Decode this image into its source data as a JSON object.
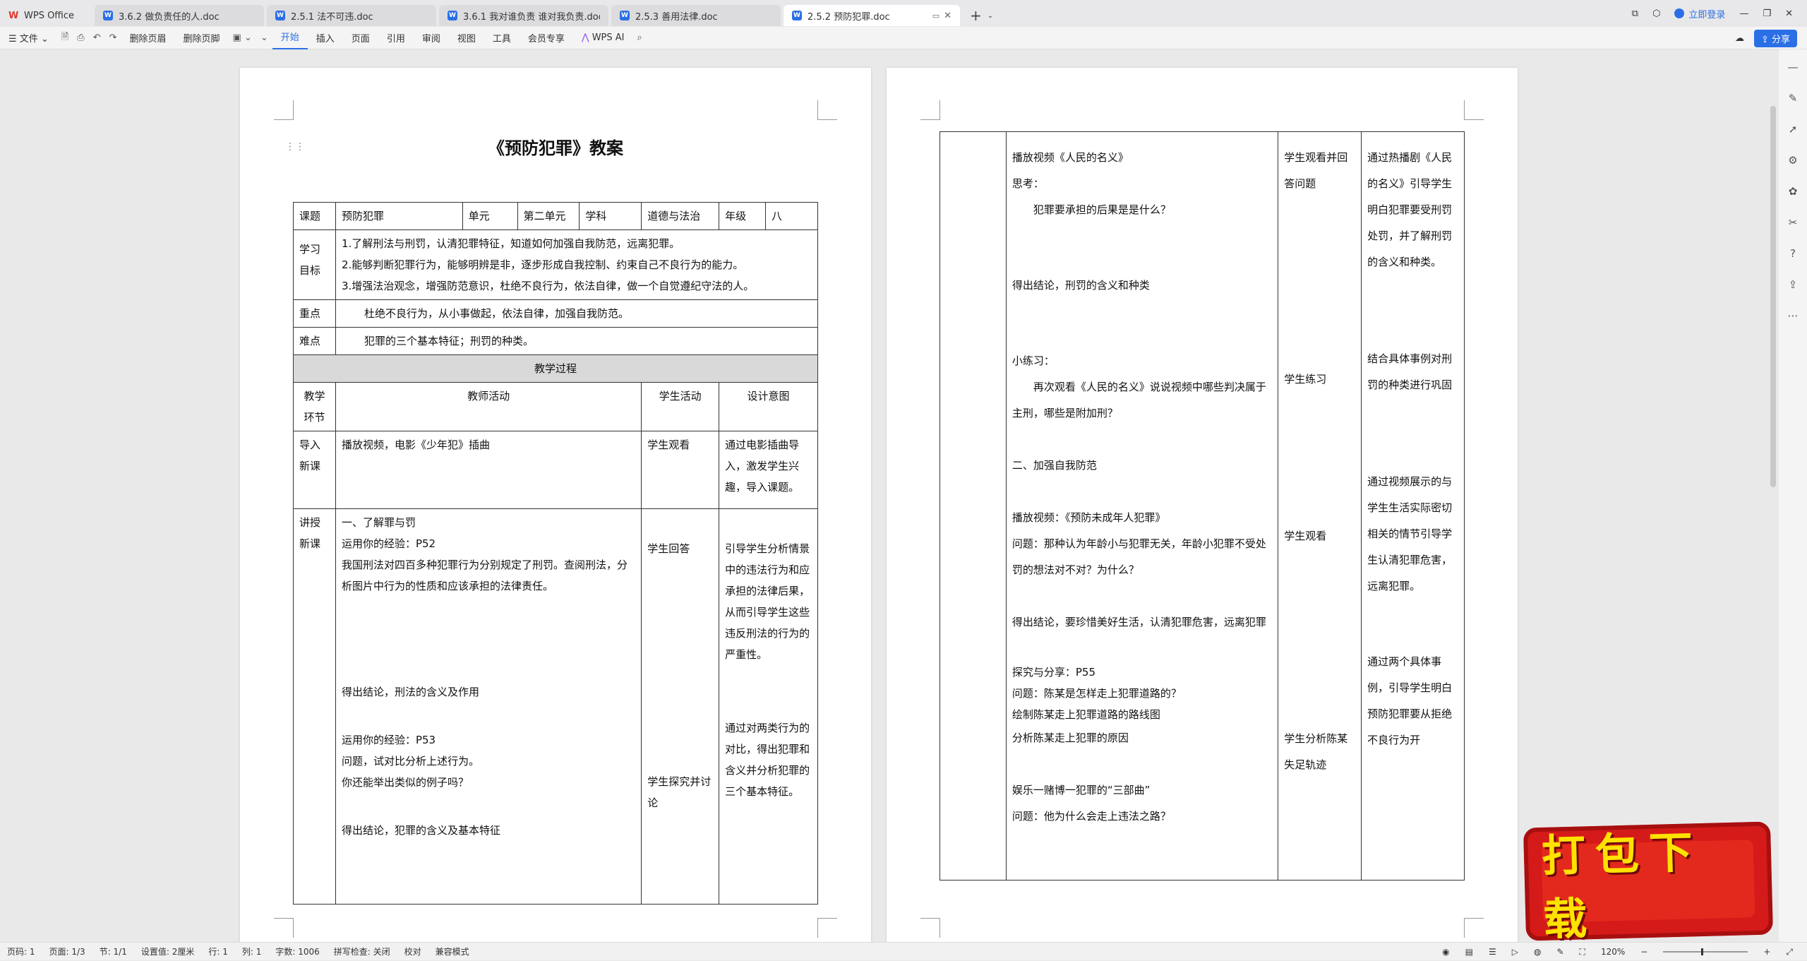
{
  "tabs": {
    "home_label": "WPS Office",
    "items": [
      {
        "label": "3.6.2 做负责任的人.doc"
      },
      {
        "label": "2.5.1 法不可违.doc"
      },
      {
        "label": "3.6.1 我对谁负责 谁对我负责.doc"
      },
      {
        "label": "2.5.3 善用法律.doc"
      },
      {
        "label": "2.5.2 预防犯罪.doc"
      }
    ],
    "login_label": "立即登录"
  },
  "menu": {
    "file": "文件",
    "delete_header": "删除页眉",
    "delete_footer": "删除页脚",
    "items": [
      "开始",
      "插入",
      "页面",
      "引用",
      "审阅",
      "视图",
      "工具",
      "会员专享"
    ],
    "ai_label": "WPS AI",
    "share_label": "分享"
  },
  "doc": {
    "title": "《预防犯罪》教案",
    "info": {
      "k_topic": "课题",
      "v_topic": "预防犯罪",
      "k_unit": "单元",
      "v_unit": "第二单元",
      "k_subject": "学科",
      "v_subject": "道德与法治",
      "k_grade": "年级",
      "v_grade": "八"
    },
    "goals_label": "学习\n目标",
    "goals": [
      "1.了解刑法与刑罚，认清犯罪特征，知道如何加强自我防范，远离犯罪。",
      "2.能够判断犯罪行为，能够明辨是非，逐步形成自我控制、约束自己不良行为的能力。",
      "3.增强法治观念，增强防范意识，杜绝不良行为，依法自律，做一个自觉遵纪守法的人。"
    ],
    "key_label": "重点",
    "key_text": "杜绝不良行为，从小事做起，依法自律，加强自我防范。",
    "difficult_label": "难点",
    "difficult_text": "犯罪的三个基本特征；刑罚的种类。",
    "process_title": "教学过程",
    "col_stage": "教学环节",
    "col_teacher": "教师活动",
    "col_student": "学生活动",
    "col_design": "设计意图",
    "row1": {
      "stage": "导入新课",
      "teacher": "播放视频，电影《少年犯》插曲",
      "student": "学生观看",
      "design": "通过电影插曲导入，激发学生兴趣，导入课题。"
    },
    "row2": {
      "stage": "讲授新课",
      "t1": "一、了解罪与罚",
      "t2": "运用你的经验：P52",
      "t3": "我国刑法对四百多种犯罪行为分别规定了刑罚。查阅刑法，分析图片中行为的性质和应该承担的法律责任。",
      "t4": "得出结论，刑法的含义及作用",
      "t5": "运用你的经验：P53",
      "t6": "问题，试对比分析上述行为。",
      "t7": "你还能举出类似的例子吗？",
      "t8": "得出结论，犯罪的含义及基本特征",
      "s1": "学生回答",
      "s2": "学生探究并讨论",
      "d1": "引导学生分析情景中的违法行为和应承担的法律后果，从而引导学生这些违反刑法的行为的严重性。",
      "d2": "通过对两类行为的对比，得出犯罪和含义并分析犯罪的三个基本特征。"
    }
  },
  "doc2": {
    "t1": "播放视频《人民的名义》",
    "t2": "思考：",
    "t3": "犯罪要承担的后果是是什么？",
    "t4": "得出结论，刑罚的含义和种类",
    "t5": "小练习：",
    "t6": "再次观看《人民的名义》说说视频中哪些判决属于主刑，哪些是附加刑？",
    "t7": "二、加强自我防范",
    "t8": "播放视频：《预防未成年人犯罪》",
    "t9": "问题：那种认为年龄小与犯罪无关，年龄小犯罪不受处罚的想法对不对？为什么？",
    "t10": "得出结论，要珍惜美好生活，认清犯罪危害，远离犯罪",
    "t11": "探究与分享：P55",
    "t12": "问题：陈某是怎样走上犯罪道路的？",
    "t13": "绘制陈某走上犯罪道路的路线图",
    "t14": "分析陈某走上犯罪的原因",
    "t15": "娱乐一赌博一犯罪的“三部曲”",
    "t16": "问题：他为什么会走上违法之路？",
    "s1": "学生观看并回答问题",
    "s2": "学生练习",
    "s3": "学生观看",
    "s4": "学生分析陈某失足轨迹",
    "d1": "通过热播剧《人民的名义》引导学生明白犯罪要受刑罚处罚，并了解刑罚的含义和种类。",
    "d2": "结合具体事例对刑罚的种类进行巩固",
    "d3": "通过视频展示的与学生生活实际密切相关的情节引导学生认清犯罪危害，远离犯罪。",
    "d4": "通过两个具体事例，引导学生明白预防犯罪要从拒绝不良行为开"
  },
  "status": {
    "page_no": "页码: 1",
    "pages": "页面: 1/3",
    "section": "节: 1/1",
    "setting": "设置值: 2厘米",
    "row": "行: 1",
    "col": "列: 1",
    "words": "字数: 1006",
    "spell": "拼写检查: 关闭",
    "proof": "校对",
    "compat": "兼容模式",
    "zoom": "120%"
  },
  "badge_text": "打包下载"
}
